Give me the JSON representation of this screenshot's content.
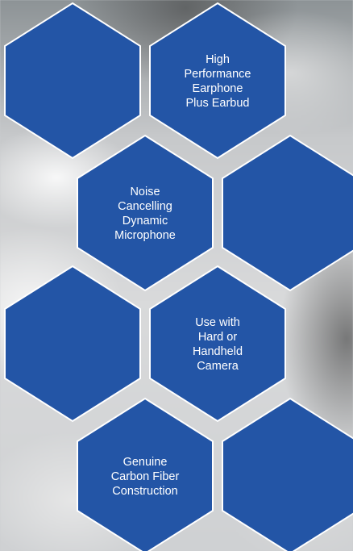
{
  "hex_fill": "#2355a6",
  "hex_stroke": "#ffffff",
  "hexagons": [
    {
      "lines": []
    },
    {
      "lines": [
        "High",
        "Performance",
        "Earphone",
        "Plus Earbud"
      ]
    },
    {
      "lines": [
        "Noise",
        "Cancelling",
        "Dynamic",
        "Microphone"
      ]
    },
    {
      "lines": []
    },
    {
      "lines": []
    },
    {
      "lines": [
        "Use with",
        "Hard or",
        "Handheld",
        "Camera"
      ]
    },
    {
      "lines": [
        "Genuine",
        "Carbon Fiber",
        "Construction"
      ]
    },
    {
      "lines": []
    }
  ]
}
